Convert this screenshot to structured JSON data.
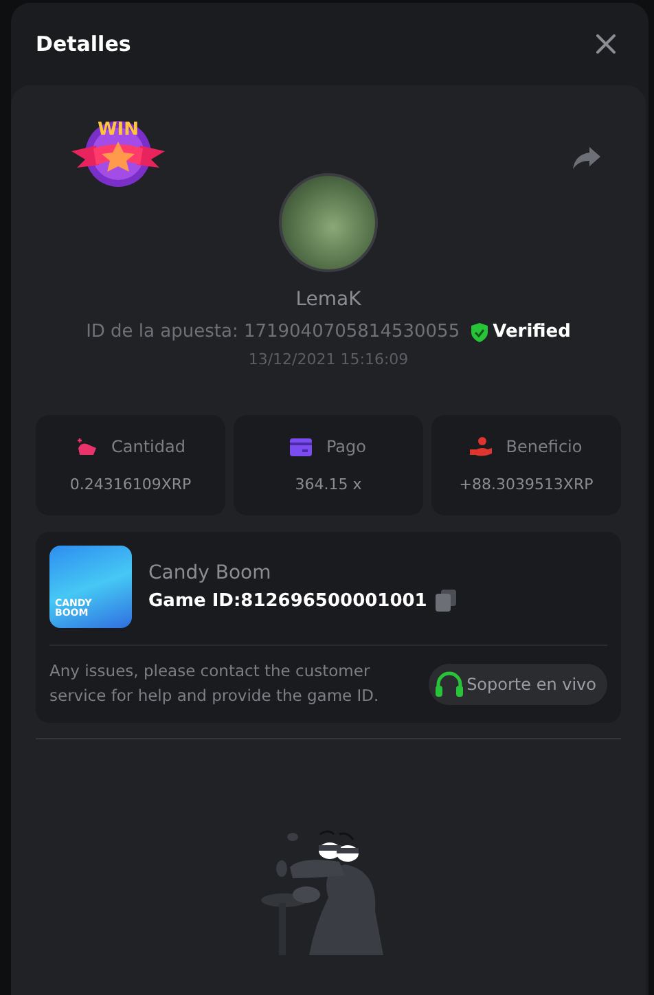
{
  "dialog": {
    "title": "Detalles"
  },
  "badge": {
    "text": "WIN"
  },
  "player": {
    "name": "LemaK",
    "bet_id_label": "ID de la apuesta: 1719040705814530055",
    "verified": true,
    "verified_label": "Verified",
    "time": "13/12/2021 15:16:09"
  },
  "stats": [
    {
      "kind": "amount",
      "label": "Cantidad",
      "value": "0.24316109XRP"
    },
    {
      "kind": "payout",
      "label": "Pago",
      "value": "364.15 x"
    },
    {
      "kind": "profit",
      "label": "Beneficio",
      "value": "+88.3039513XRP"
    }
  ],
  "game": {
    "name": "Candy Boom",
    "id_label": "Game ID:",
    "id": "812696500001001",
    "thumbnail_text": "CANDY BOOM",
    "note": "Any issues, please contact the customer service for help and provide the game ID.",
    "support_button": "Soporte en vivo"
  }
}
